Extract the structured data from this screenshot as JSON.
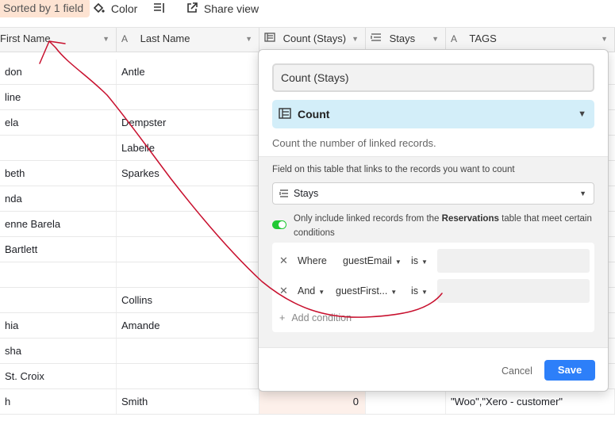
{
  "toolbar": {
    "sorted_label": "Sorted by 1 field",
    "color_label": "Color",
    "share_label": "Share view"
  },
  "columns": [
    {
      "label": "First Name",
      "icon": "text-icon"
    },
    {
      "label": "Last Name",
      "icon": "text-icon"
    },
    {
      "label": "Count (Stays)",
      "icon": "count-icon"
    },
    {
      "label": "Stays",
      "icon": "link-icon"
    },
    {
      "label": "TAGS",
      "icon": "text-icon"
    }
  ],
  "rows": [
    {
      "first": "don",
      "last": "Antle",
      "count": "",
      "tags": ""
    },
    {
      "first": "line",
      "last": "",
      "count": "",
      "tags": ""
    },
    {
      "first": "ela",
      "last": "Dempster",
      "count": "",
      "tags": ""
    },
    {
      "first": "",
      "last": "Labelle",
      "count": "",
      "tags": ""
    },
    {
      "first": "beth",
      "last": "Sparkes",
      "count": "",
      "tags": ""
    },
    {
      "first": "nda",
      "last": "",
      "count": "",
      "tags": ""
    },
    {
      "first": "enne Barela",
      "last": "",
      "count": "",
      "tags": ""
    },
    {
      "first": "Bartlett",
      "last": "",
      "count": "",
      "tags": ""
    },
    {
      "first": "",
      "last": "",
      "count": "",
      "tags": ""
    },
    {
      "first": "",
      "last": "Collins",
      "count": "",
      "tags": ""
    },
    {
      "first": "hia",
      "last": "Amande",
      "count": "",
      "tags": ""
    },
    {
      "first": "sha",
      "last": "",
      "count": "",
      "tags": ""
    },
    {
      "first": "St. Croix",
      "last": "",
      "count": "",
      "tags": ""
    },
    {
      "first": "h",
      "last": "Smith",
      "count": "0",
      "tags": "\"Woo\",\"Xero - customer\""
    }
  ],
  "dialog": {
    "field_name": "Count (Stays)",
    "field_type": "Count",
    "description": "Count the number of linked records.",
    "link_field_label": "Field on this table that links to the records you want to count",
    "link_field_value": "Stays",
    "toggle_text_1": "Only include linked records from the ",
    "toggle_table": "Reservations",
    "toggle_text_2": " table that meet certain conditions",
    "conditions": [
      {
        "conj": "Where",
        "field": "guestEmail",
        "op": "is"
      },
      {
        "conj": "And",
        "field": "guestFirst...",
        "op": "is"
      }
    ],
    "add_condition": "Add condition",
    "cancel_label": "Cancel",
    "save_label": "Save"
  },
  "colors": {
    "accent": "#2d7ff9",
    "toggle_on": "#20c933",
    "type_bg": "#d3eef9",
    "annotation": "#c8102e"
  }
}
